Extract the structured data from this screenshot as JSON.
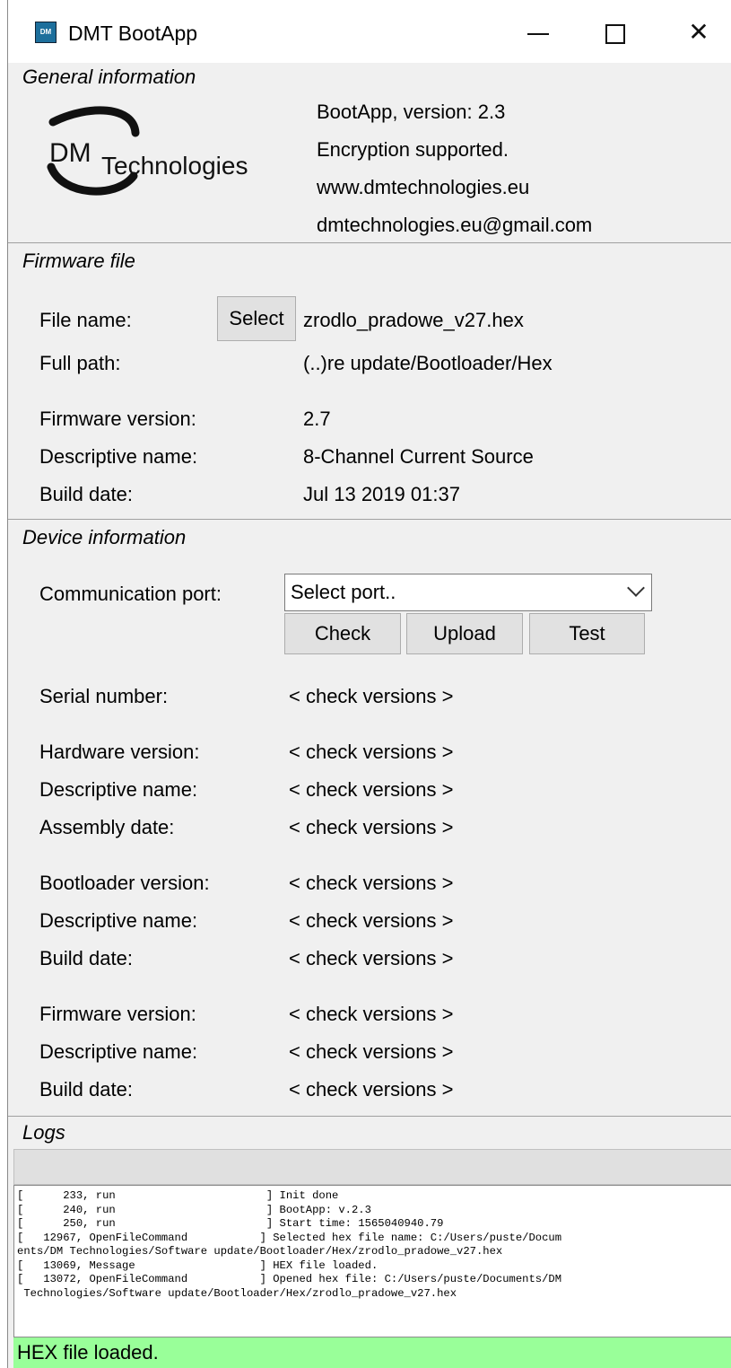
{
  "window": {
    "title": "DMT BootApp",
    "icon": "dmt-app-icon",
    "icon_text": "DM",
    "controls": {
      "minimize": "minimize-icon",
      "maximize": "maximize-icon",
      "close": "close-icon"
    },
    "close_glyph": "✕"
  },
  "general": {
    "title": "General information",
    "logo_text_dm": "DM",
    "logo_text_rest": "Technologies",
    "version": "BootApp, version: 2.3",
    "encryption": "Encryption supported.",
    "website": "www.dmtechnologies.eu",
    "email": "dmtechnologies.eu@gmail.com"
  },
  "firmware_file": {
    "title": "Firmware file",
    "file_name_label": "File name:",
    "select_label": "Select",
    "file_name_value": "zrodlo_pradowe_v27.hex",
    "full_path_label": "Full path:",
    "full_path_value": "(..)re update/Bootloader/Hex",
    "fw_version_label": "Firmware version:",
    "fw_version_value": "2.7",
    "desc_name_label": "Descriptive name:",
    "desc_name_value": "8-Channel Current Source",
    "build_date_label": "Build date:",
    "build_date_value": "Jul 13 2019 01:37"
  },
  "device": {
    "title": "Device information",
    "port_label": "Communication port:",
    "port_value": "Select port..",
    "check_label": "Check",
    "upload_label": "Upload",
    "test_label": "Test",
    "serial_label": "Serial number:",
    "serial_value": "< check versions >",
    "hw_version_label": "Hardware version:",
    "hw_version_value": "< check versions >",
    "hw_desc_label": "Descriptive name:",
    "hw_desc_value": "< check versions >",
    "assembly_label": "Assembly date:",
    "assembly_value": "< check versions >",
    "bl_version_label": "Bootloader version:",
    "bl_version_value": "< check versions >",
    "bl_desc_label": "Descriptive name:",
    "bl_desc_value": "< check versions >",
    "bl_build_label": "Build date:",
    "bl_build_value": "< check versions >",
    "fw_version_label": "Firmware version:",
    "fw_version_value": "< check versions >",
    "fw_desc_label": "Descriptive name:",
    "fw_desc_value": "< check versions >",
    "fw_build_label": "Build date:",
    "fw_build_value": "< check versions >"
  },
  "logs": {
    "title": "Logs",
    "text": "[      233, run                       ] Init done\n[      240, run                       ] BootApp: v.2.3\n[      250, run                       ] Start time: 1565040940.79\n[   12967, OpenFileCommand           ] Selected hex file name: C:/Users/puste/Docum\nents/DM Technologies/Software update/Bootloader/Hex/zrodlo_pradowe_v27.hex\n[   13069, Message                   ] HEX file loaded.\n[   13072, OpenFileCommand           ] Opened hex file: C:/Users/puste/Documents/DM\n Technologies/Software update/Bootloader/Hex/zrodlo_pradowe_v27.hex",
    "status": "HEX file loaded.",
    "status_color": "#99ff99"
  }
}
